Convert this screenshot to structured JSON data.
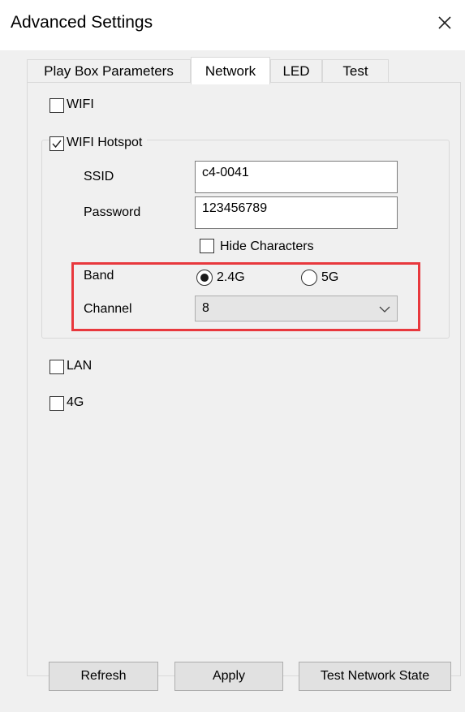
{
  "window": {
    "title": "Advanced Settings"
  },
  "tabs": [
    "Play Box Parameters",
    "Network",
    "LED",
    "Test"
  ],
  "network": {
    "wifi_label": "WIFI",
    "wifi_checked": false,
    "hotspot_label": "WIFI Hotspot",
    "hotspot_checked": true,
    "ssid_label": "SSID",
    "ssid_value": "c4-0041",
    "password_label": "Password",
    "password_value": "123456789",
    "hide_chars_label": "Hide Characters",
    "hide_chars_checked": false,
    "band_label": "Band",
    "band_options": [
      "2.4G",
      "5G"
    ],
    "band_selected": "2.4G",
    "channel_label": "Channel",
    "channel_value": "8",
    "lan_label": "LAN",
    "lan_checked": false,
    "g4_label": "4G",
    "g4_checked": false
  },
  "buttons": {
    "refresh": "Refresh",
    "apply": "Apply",
    "test_network": "Test Network State"
  },
  "colors": {
    "highlight": "#e8383d",
    "background": "#f0f0f0"
  }
}
